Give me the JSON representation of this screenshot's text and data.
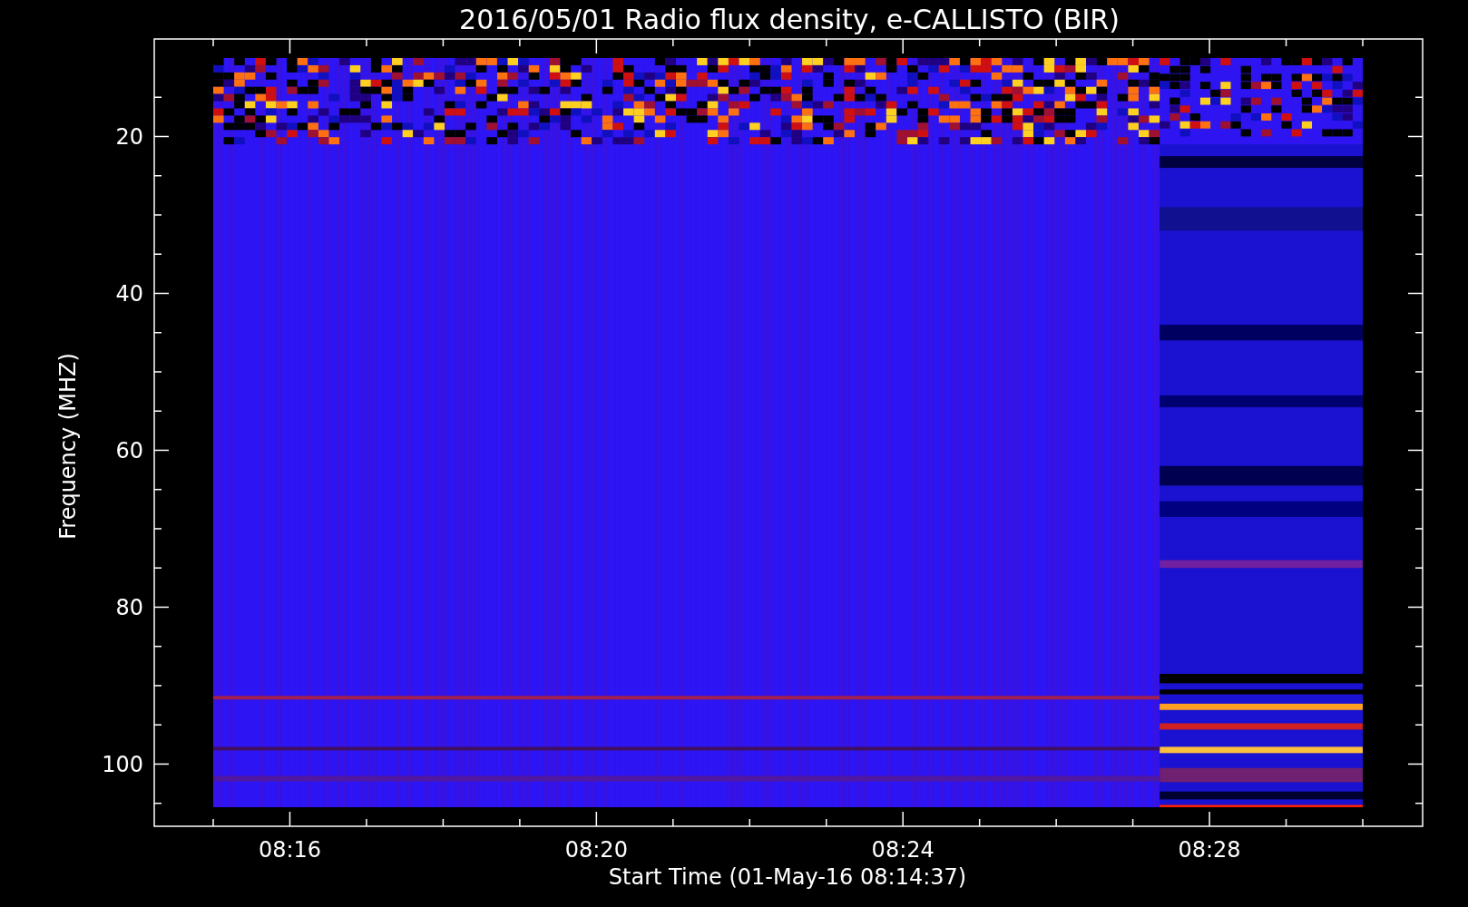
{
  "title": "2016/05/01  Radio flux density, e-CALLISTO (BIR)",
  "ylabel": "Frequency (MHZ)",
  "xlabel": "Start Time (01-May-16 08:14:37)",
  "y_ticks": [
    "20",
    "40",
    "60",
    "80",
    "100"
  ],
  "x_ticks": [
    "08:16",
    "08:20",
    "08:24",
    "08:28"
  ]
}
